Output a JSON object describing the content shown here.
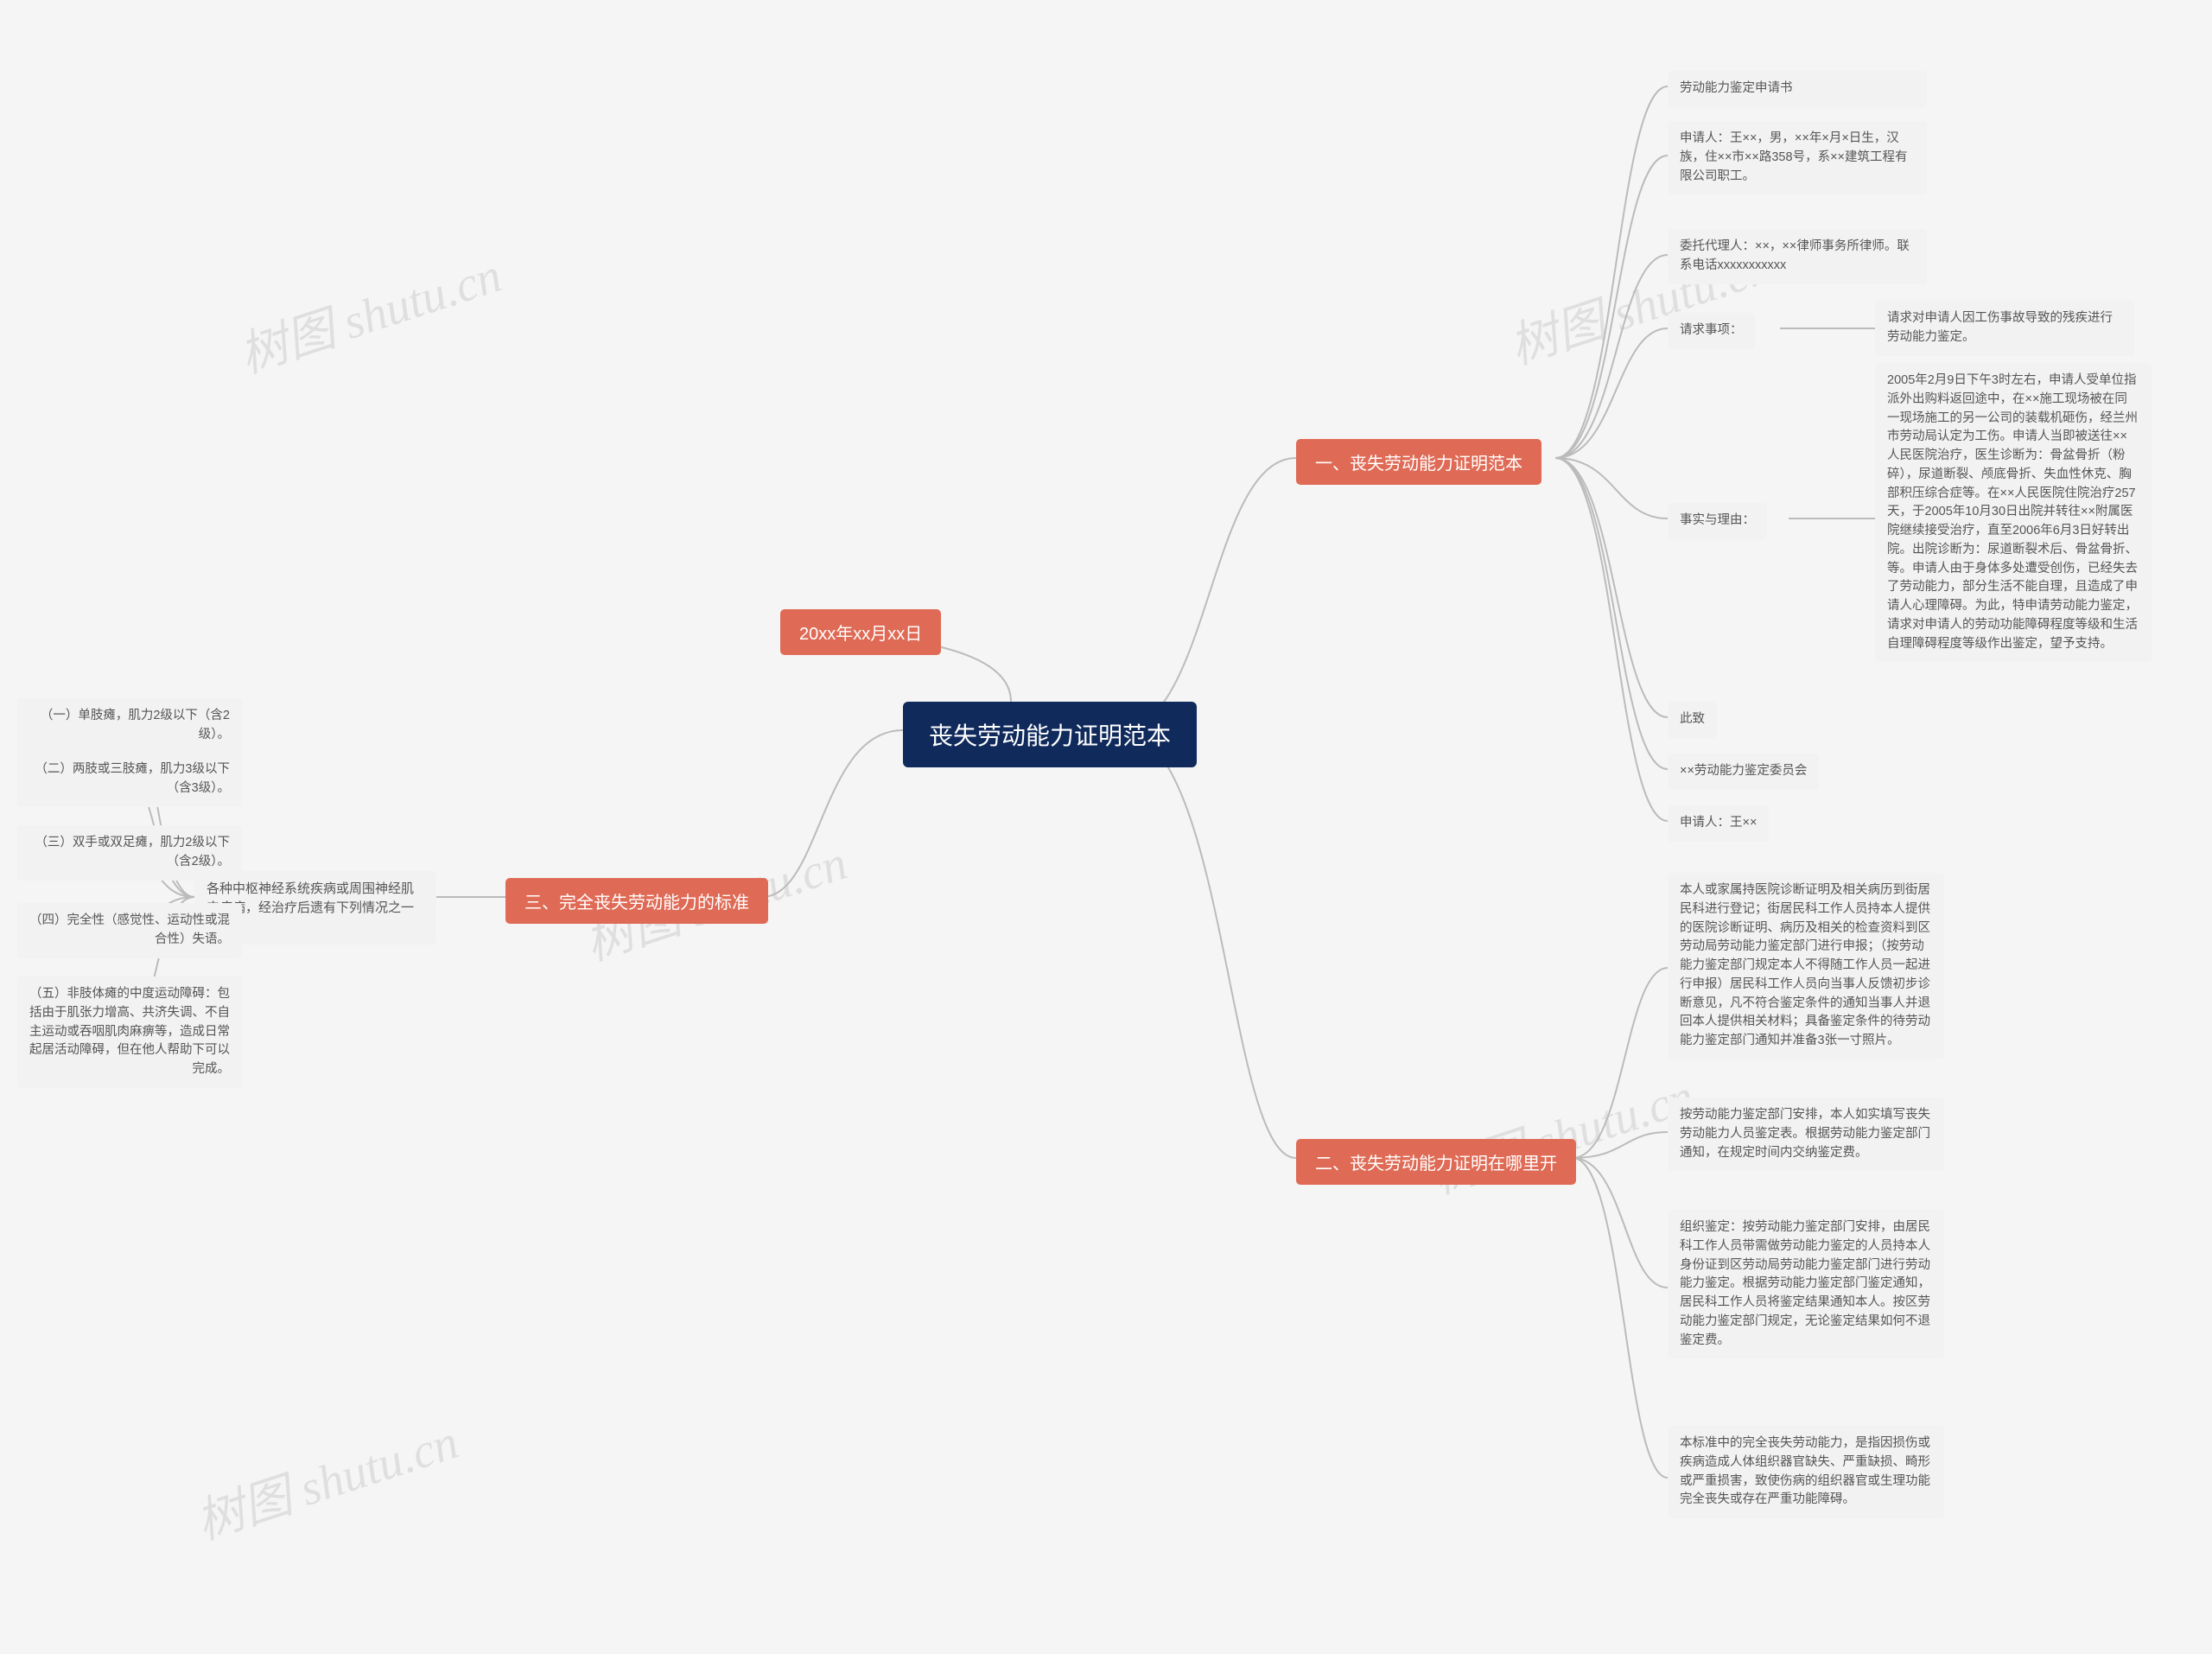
{
  "root": "丧失劳动能力证明范本",
  "date_branch": "20xx年xx月xx日",
  "branches": {
    "one": {
      "title": "一、丧失劳动能力证明范本",
      "items": {
        "a": "劳动能力鉴定申请书",
        "b": "申请人：王××，男，××年×月×日生，汉族，住××市××路358号，系××建筑工程有限公司职工。",
        "c": "委托代理人：××，××律师事务所律师。联系电话xxxxxxxxxxx",
        "d_label": "请求事项：",
        "d_content": "请求对申请人因工伤事故导致的残疾进行劳动能力鉴定。",
        "e_label": "事实与理由：",
        "e_content": "2005年2月9日下午3时左右，申请人受单位指派外出购料返回途中，在××施工现场被在同一现场施工的另一公司的装载机砸伤，经兰州市劳动局认定为工伤。申请人当即被送往××人民医院治疗，医生诊断为：骨盆骨折（粉碎），尿道断裂、颅底骨折、失血性休克、胸部积压综合症等。在××人民医院住院治疗257天，于2005年10月30日出院并转往××附属医院继续接受治疗，直至2006年6月3日好转出院。出院诊断为：尿道断裂术后、骨盆骨折、等。申请人由于身体多处遭受创伤，已经失去了劳动能力，部分生活不能自理，且造成了申请人心理障碍。为此，特申请劳动能力鉴定，请求对申请人的劳动功能障碍程度等级和生活自理障碍程度等级作出鉴定，望予支持。",
        "f": "此致",
        "g": "××劳动能力鉴定委员会",
        "h": "申请人：王××"
      }
    },
    "two": {
      "title": "二、丧失劳动能力证明在哪里开",
      "items": {
        "a": "本人或家属持医院诊断证明及相关病历到街居民科进行登记；街居民科工作人员持本人提供的医院诊断证明、病历及相关的检查资料到区劳动局劳动能力鉴定部门进行申报；（按劳动能力鉴定部门规定本人不得随工作人员一起进行申报）居民科工作人员向当事人反馈初步诊断意见，凡不符合鉴定条件的通知当事人并退回本人提供相关材料；具备鉴定条件的待劳动能力鉴定部门通知并准备3张一寸照片。",
        "b": "按劳动能力鉴定部门安排，本人如实填写丧失劳动能力人员鉴定表。根据劳动能力鉴定部门通知，在规定时间内交纳鉴定费。",
        "c": "组织鉴定：按劳动能力鉴定部门安排，由居民科工作人员带需做劳动能力鉴定的人员持本人身份证到区劳动局劳动能力鉴定部门进行劳动能力鉴定。根据劳动能力鉴定部门鉴定通知，居民科工作人员将鉴定结果通知本人。按区劳动能力鉴定部门规定，无论鉴定结果如何不退鉴定费。",
        "d": "本标准中的完全丧失劳动能力，是指因损伤或疾病造成人体组织器官缺失、严重缺损、畸形或严重损害，致使伤病的组织器官或生理功能完全丧失或存在严重功能障碍。"
      }
    },
    "three": {
      "title": "三、完全丧失劳动能力的标准",
      "sub": "各种中枢神经系统疾病或周围神经肌肉疾病，经治疗后遗有下列情况之一者：",
      "items": {
        "a": "（一）单肢瘫，肌力2级以下（含2级）。",
        "b": "（二）两肢或三肢瘫，肌力3级以下（含3级）。",
        "c": "（三）双手或双足瘫，肌力2级以下（含2级）。",
        "d": "（四）完全性（感觉性、运动性或混合性）失语。",
        "e": "（五）非肢体瘫的中度运动障碍：包括由于肌张力增高、共济失调、不自主运动或吞咽肌肉麻痹等，造成日常起居活动障碍，但在他人帮助下可以完成。"
      }
    }
  },
  "watermark": "树图 shutu.cn"
}
